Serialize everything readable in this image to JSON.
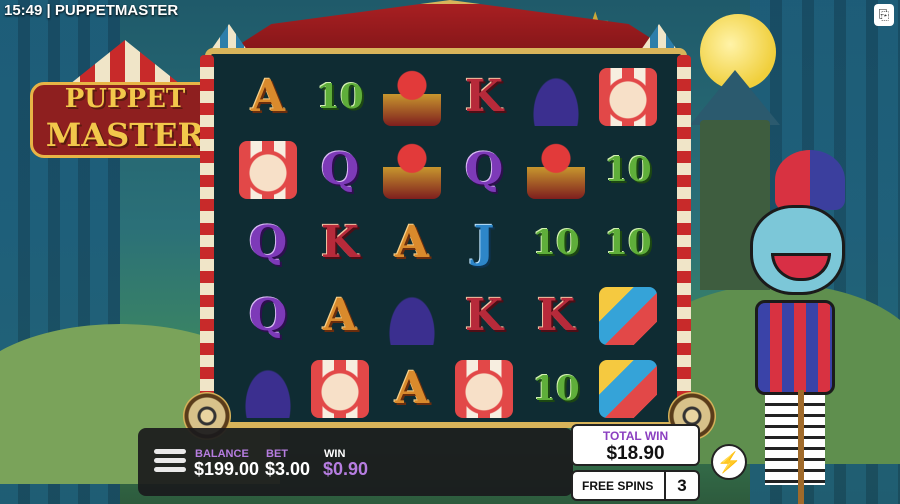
{
  "status": {
    "time": "15:49",
    "separator": "|",
    "title": "PUPPETMASTER"
  },
  "logo": {
    "line1": "PUPPET",
    "line2": "MASTER"
  },
  "reels": {
    "rows": [
      [
        "A",
        "10",
        "jack-in-box",
        "K",
        "bunny-hat",
        "clown-popcorn"
      ],
      [
        "clown-popcorn",
        "Q",
        "jack-in-box",
        "Q",
        "jack-in-box",
        "10"
      ],
      [
        "Q",
        "K",
        "A",
        "J",
        "10",
        "10"
      ],
      [
        "Q",
        "A",
        "bunny-hat",
        "K",
        "K",
        "cannon"
      ],
      [
        "bunny-hat",
        "clown-popcorn",
        "A",
        "clown-popcorn",
        "10",
        "cannon"
      ]
    ]
  },
  "hud": {
    "menu_icon": "hamburger-menu-icon",
    "balance_label": "BALANCE",
    "balance_value": "$199.00",
    "bet_label": "BET",
    "bet_value": "$3.00",
    "win_label": "WIN",
    "win_value": "$0.90"
  },
  "total_win": {
    "label": "TOTAL WIN",
    "value": "$18.90"
  },
  "free_spins": {
    "label": "FREE SPINS",
    "count": "3"
  },
  "turbo": {
    "icon": "lightning-bolt-icon",
    "glyph": "⚡"
  },
  "colors": {
    "accent_purple": "#b67de0",
    "frame_gold": "#d8b45a",
    "tent_red": "#c82a2a"
  }
}
